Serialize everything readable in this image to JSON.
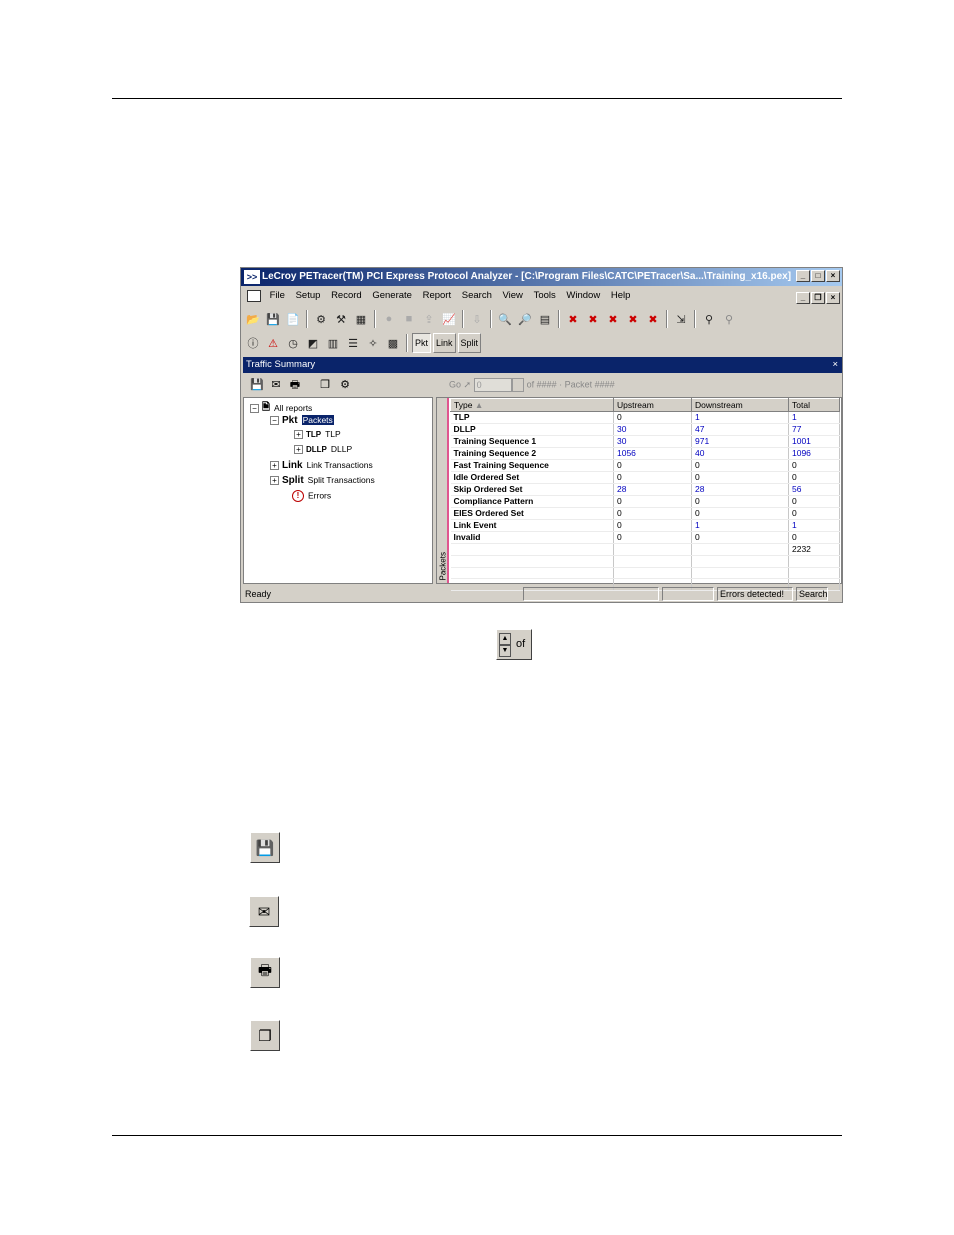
{
  "window": {
    "title": "LeCroy PETracer(TM) PCI Express Protocol Analyzer - [C:\\Program Files\\CATC\\PETracer\\Sa...\\Training_x16.pex]",
    "logo": ">>",
    "min": "_",
    "max": "□",
    "close": "×",
    "restore": "❐"
  },
  "menu": [
    "File",
    "Setup",
    "Record",
    "Generate",
    "Report",
    "Search",
    "View",
    "Tools",
    "Window",
    "Help"
  ],
  "toolbar3": {
    "pkt": "Pkt",
    "link": "Link",
    "split": "Split"
  },
  "panel": {
    "title": "Traffic Summary",
    "close": "×",
    "go_label": "Go",
    "go_value": "0",
    "of_text": "of ####",
    "packet_text": "Packet ####"
  },
  "tree": {
    "all_reports": "All reports",
    "pkt_icon": "Pkt",
    "packets": "Packets",
    "tlp_icon": "TLP",
    "tlp": "TLP",
    "dllp_icon": "DLLP",
    "dllp": "DLLP",
    "link_icon": "Link",
    "link": "Link Transactions",
    "split_icon": "Split",
    "split": "Split Transactions",
    "errors": "Errors"
  },
  "table": {
    "tab_label": "Packets",
    "columns": [
      "Type",
      "Upstream",
      "Downstream",
      "Total"
    ],
    "rows": [
      {
        "type": "TLP",
        "up": "0",
        "down": "1",
        "total": "1"
      },
      {
        "type": "DLLP",
        "up": "30",
        "down": "47",
        "total": "77"
      },
      {
        "type": "Training Sequence 1",
        "up": "30",
        "down": "971",
        "total": "1001"
      },
      {
        "type": "Training Sequence 2",
        "up": "1056",
        "down": "40",
        "total": "1096"
      },
      {
        "type": "Fast Training Sequence",
        "up": "0",
        "down": "0",
        "total": "0"
      },
      {
        "type": "Idle Ordered Set",
        "up": "0",
        "down": "0",
        "total": "0"
      },
      {
        "type": "Skip Ordered Set",
        "up": "28",
        "down": "28",
        "total": "56"
      },
      {
        "type": "Compliance Pattern",
        "up": "0",
        "down": "0",
        "total": "0"
      },
      {
        "type": "EIES Ordered Set",
        "up": "0",
        "down": "0",
        "total": "0"
      },
      {
        "type": "Link Event",
        "up": "0",
        "down": "1",
        "total": "1"
      },
      {
        "type": "Invalid",
        "up": "0",
        "down": "0",
        "total": "0"
      }
    ],
    "grand_total": "2232"
  },
  "status": {
    "ready": "Ready",
    "errors": "Errors detected!",
    "search": "Search"
  },
  "doc": {
    "spin_of": "of"
  }
}
